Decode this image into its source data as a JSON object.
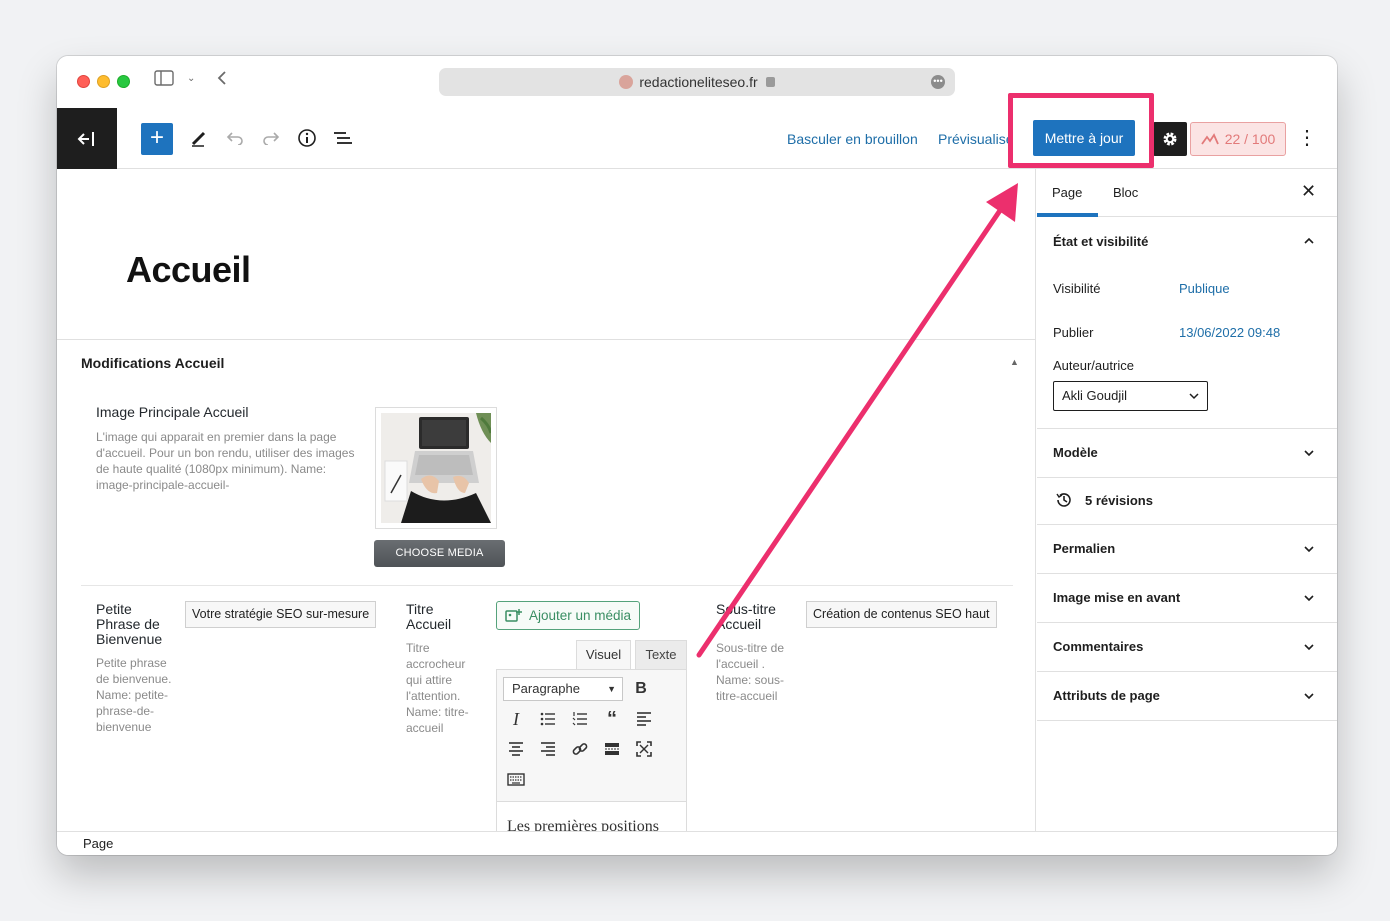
{
  "browser": {
    "url": "redactioneliteseo.fr"
  },
  "toolbar": {
    "draft_label": "Basculer en brouillon",
    "preview_label": "Prévisualiser",
    "update_label": "Mettre à jour",
    "seo_score": "22 / 100"
  },
  "editor": {
    "page_title": "Accueil",
    "meta_box_title": "Modifications Accueil",
    "image_field": {
      "label": "Image Principale Accueil",
      "description": "L'image qui apparait en premier dans la page d'accueil. Pour un bon rendu, utiliser des images de haute qualité (1080px minimum). Name: image-principale-accueil-",
      "button": "CHOOSE MEDIA"
    },
    "fields": [
      {
        "label": "Petite Phrase de Bienvenue",
        "description": "Petite phrase de bienvenue. Name: petite-phrase-de-bienvenue",
        "value": "Votre stratégie SEO sur-mesure"
      },
      {
        "label": "Titre Accueil",
        "description": "Titre accrocheur qui attire l'attention. Name: titre-accueil"
      },
      {
        "label": "Sous-titre Accueil",
        "description": "Sous-titre de l'accueil . Name: sous-titre-accueil",
        "value": "Création de contenus SEO haut"
      }
    ],
    "add_media_label": "Ajouter un média",
    "tab_visual": "Visuel",
    "tab_text": "Texte",
    "format_select": "Paragraphe",
    "content_preview": "Les premières positions"
  },
  "statusbar": {
    "label": "Page"
  },
  "sidebar": {
    "tab_page": "Page",
    "tab_block": "Bloc",
    "status_title": "État et visibilité",
    "visibility_label": "Visibilité",
    "visibility_value": "Publique",
    "publish_label": "Publier",
    "publish_value": "13/06/2022 09:48",
    "author_label": "Auteur/autrice",
    "author_value": "Akli Goudjil",
    "template_title": "Modèle",
    "revisions": "5 révisions",
    "permalink_title": "Permalien",
    "featured_image_title": "Image mise en avant",
    "comments_title": "Commentaires",
    "page_attributes_title": "Attributs de page"
  },
  "colors": {
    "primary": "#1e73be",
    "annotation": "#ec2f6d",
    "link": "#1e6ea8"
  }
}
